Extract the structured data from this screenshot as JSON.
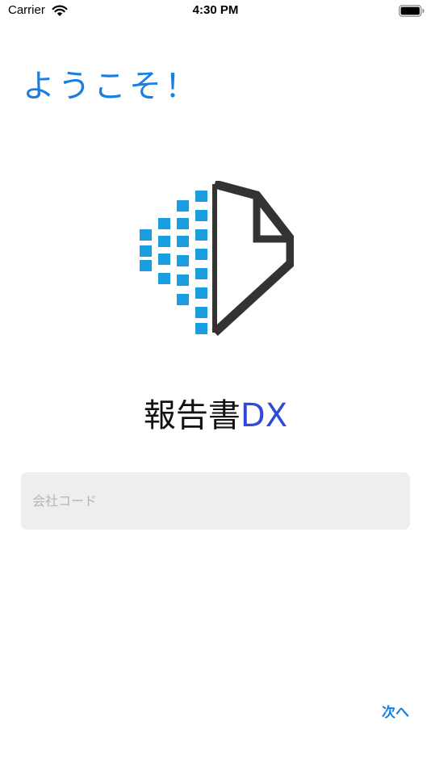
{
  "status_bar": {
    "carrier": "Carrier",
    "time": "4:30 PM"
  },
  "welcome": {
    "title": "ようこそ！"
  },
  "app": {
    "name_main": "報告書",
    "name_suffix": "DX"
  },
  "form": {
    "company_code_placeholder": "会社コード",
    "company_code_value": ""
  },
  "actions": {
    "next_label": "次へ"
  },
  "colors": {
    "accent": "#1a7fe0",
    "logo_blue": "#1a9ee0",
    "logo_dark": "#333333",
    "dx_blue": "#2e4bdc",
    "input_bg": "#eeeeee"
  },
  "icons": [
    "wifi-icon",
    "battery-icon",
    "app-logo-icon"
  ]
}
